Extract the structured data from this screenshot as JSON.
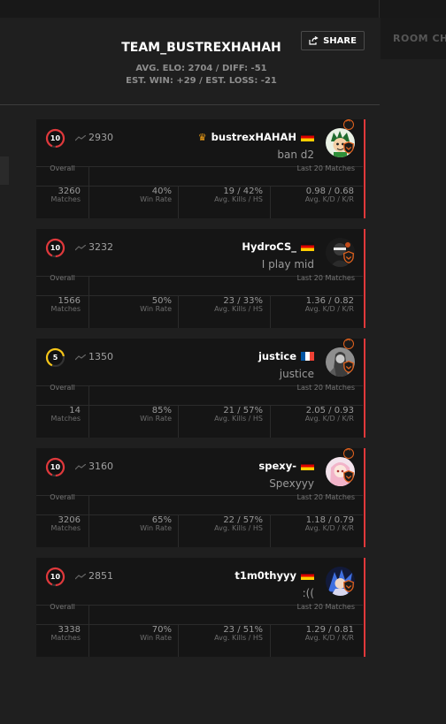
{
  "room_tab_label": "ROOM CH",
  "team": {
    "name": "TEAM_BUSTREXHAHAH",
    "elo_line": "AVG. ELO: 2704 / DIFF: -51",
    "est_line": "EST. WIN: +29 / EST. LOSS: -21"
  },
  "share_label": "SHARE",
  "labels": {
    "overall": "Overall",
    "last20": "Last 20 Matches",
    "matches": "Matches",
    "win_rate": "Win Rate",
    "kills_hs": "Avg. Kills / HS",
    "kd_kr": "Avg. K/D / K/R"
  },
  "colors": {
    "accent": "#e0383b",
    "level10": "#e0383b",
    "level5": "#f5c518",
    "crown": "#f2a017"
  },
  "players": [
    {
      "level": "10",
      "elo": "2930",
      "nick": "bustrexHAHAH",
      "crown": true,
      "crown_icon": "♛",
      "flag": "de",
      "status": "ban d2",
      "skill_badge": true,
      "avatar": "cartoon-boy",
      "matches": "3260",
      "win_rate": "40%",
      "kills_hs": "19 / 42%",
      "kd_kr": "0.98 / 0.68"
    },
    {
      "level": "10",
      "elo": "3232",
      "nick": "HydroCS_",
      "crown": false,
      "flag": "de",
      "status": "I play mid",
      "skill_badge": false,
      "avatar": "dark-figure",
      "matches": "1566",
      "win_rate": "50%",
      "kills_hs": "23 / 33%",
      "kd_kr": "1.36 / 0.82"
    },
    {
      "level": "5",
      "elo": "1350",
      "nick": "justice",
      "crown": false,
      "flag": "fr",
      "status": "justice",
      "skill_badge": true,
      "avatar": "grey-character",
      "matches": "14",
      "win_rate": "85%",
      "kills_hs": "21 / 57%",
      "kd_kr": "2.05 / 0.93"
    },
    {
      "level": "10",
      "elo": "3160",
      "nick": "spexy-",
      "crown": false,
      "flag": "de",
      "status": "Spexyyy",
      "skill_badge": true,
      "avatar": "pink-anime",
      "matches": "3206",
      "win_rate": "65%",
      "kills_hs": "22 / 57%",
      "kd_kr": "1.18 / 0.79"
    },
    {
      "level": "10",
      "elo": "2851",
      "nick": "t1m0thyyy",
      "crown": false,
      "flag": "de",
      "status": ":((",
      "skill_badge": false,
      "avatar": "blue-anime",
      "matches": "3338",
      "win_rate": "70%",
      "kills_hs": "23 / 51%",
      "kd_kr": "1.29 / 0.81"
    }
  ]
}
